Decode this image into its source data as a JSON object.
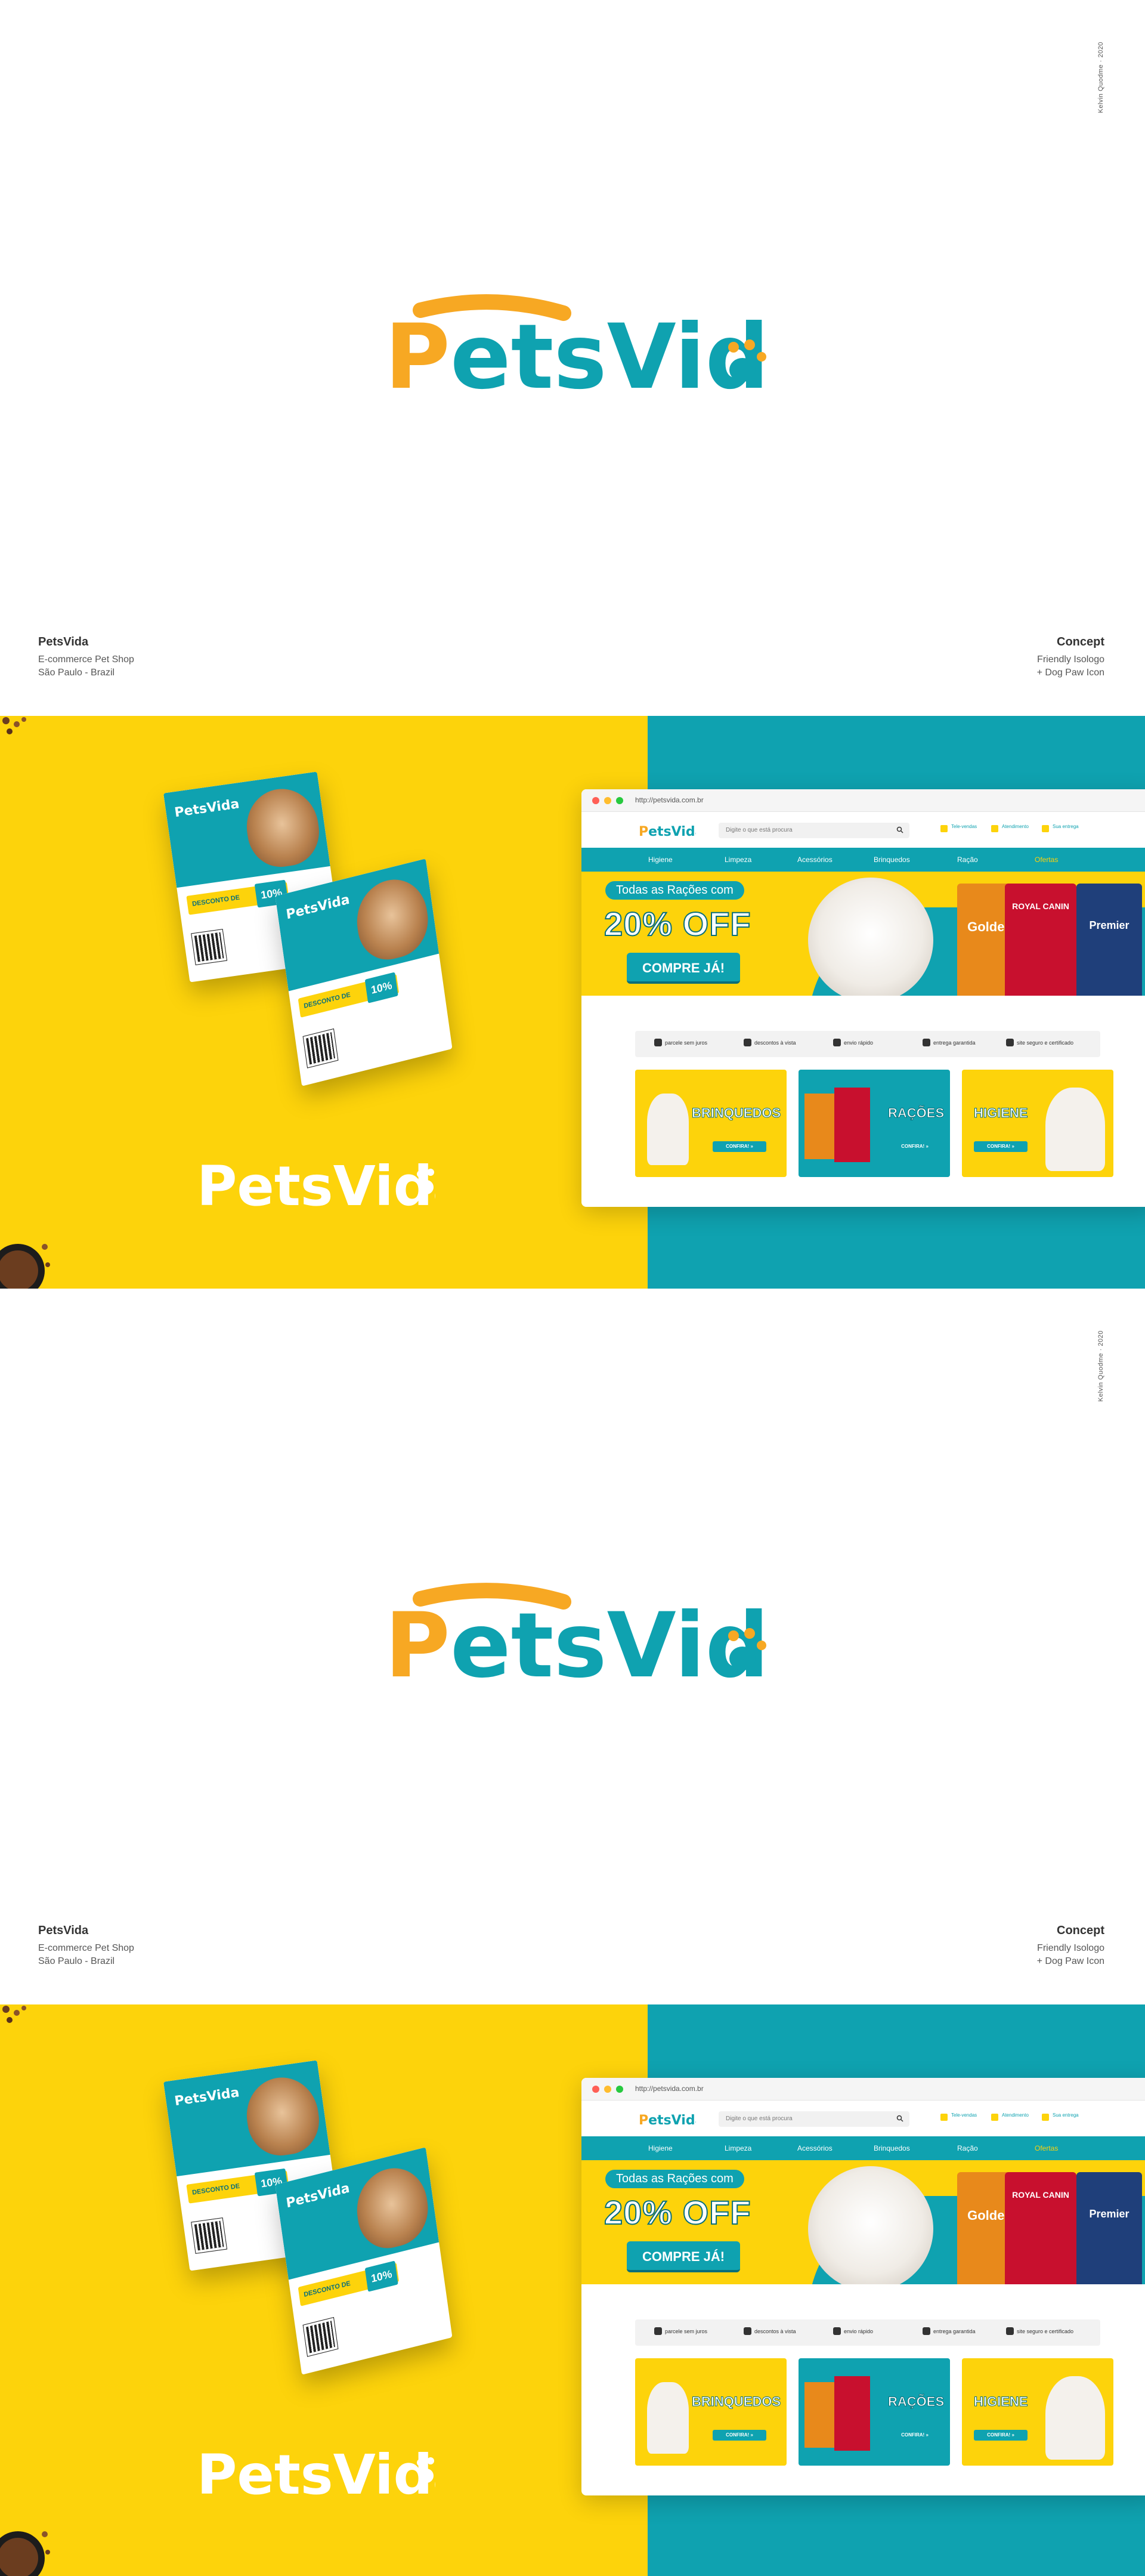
{
  "brand": {
    "name_part1": "Pets",
    "name_part2": "Vida",
    "colors": {
      "yellow": "#fdd30b",
      "teal": "#0fa2b0",
      "orange": "#f7a823",
      "dark_teal": "#0a6f79"
    }
  },
  "credit": "Kelvin Quodme · 2020",
  "project_info": {
    "title": "PetsVida",
    "line1": "E-commerce Pet Shop",
    "line2": "São Paulo - Brazil"
  },
  "concept_info": {
    "title": "Concept",
    "line1": "Friendly Isologo",
    "line2": "+ Dog Paw Icon"
  },
  "flyer": {
    "discount_label": "DESCONTO DE",
    "discount_value": "10%"
  },
  "browser": {
    "url": "http://petsvida.com.br",
    "search_placeholder": "Digite o que está procura",
    "header_items": [
      "Tele-vendas",
      "Atendimento",
      "Sua entrega"
    ],
    "nav": [
      "Higiene",
      "Limpeza",
      "Acessórios",
      "Brinquedos",
      "Ração",
      "Ofertas"
    ],
    "hero": {
      "tag": "Todas as Rações com",
      "headline": "20% OFF",
      "button": "COMPRE JÁ!"
    },
    "bags": [
      "Golden",
      "ROYAL CANIN",
      "Premier"
    ],
    "features": [
      "parcele sem juros",
      "descontos à vista",
      "envio rápido",
      "entrega garantida",
      "site seguro e certificado"
    ],
    "cards": [
      {
        "title": "BRINQUEDOS",
        "button": "CONFIRA! »"
      },
      {
        "title": "RAÇÕES",
        "button": "CONFIRA! »"
      },
      {
        "title": "HIGIENE",
        "button": "CONFIRA! »"
      }
    ]
  }
}
